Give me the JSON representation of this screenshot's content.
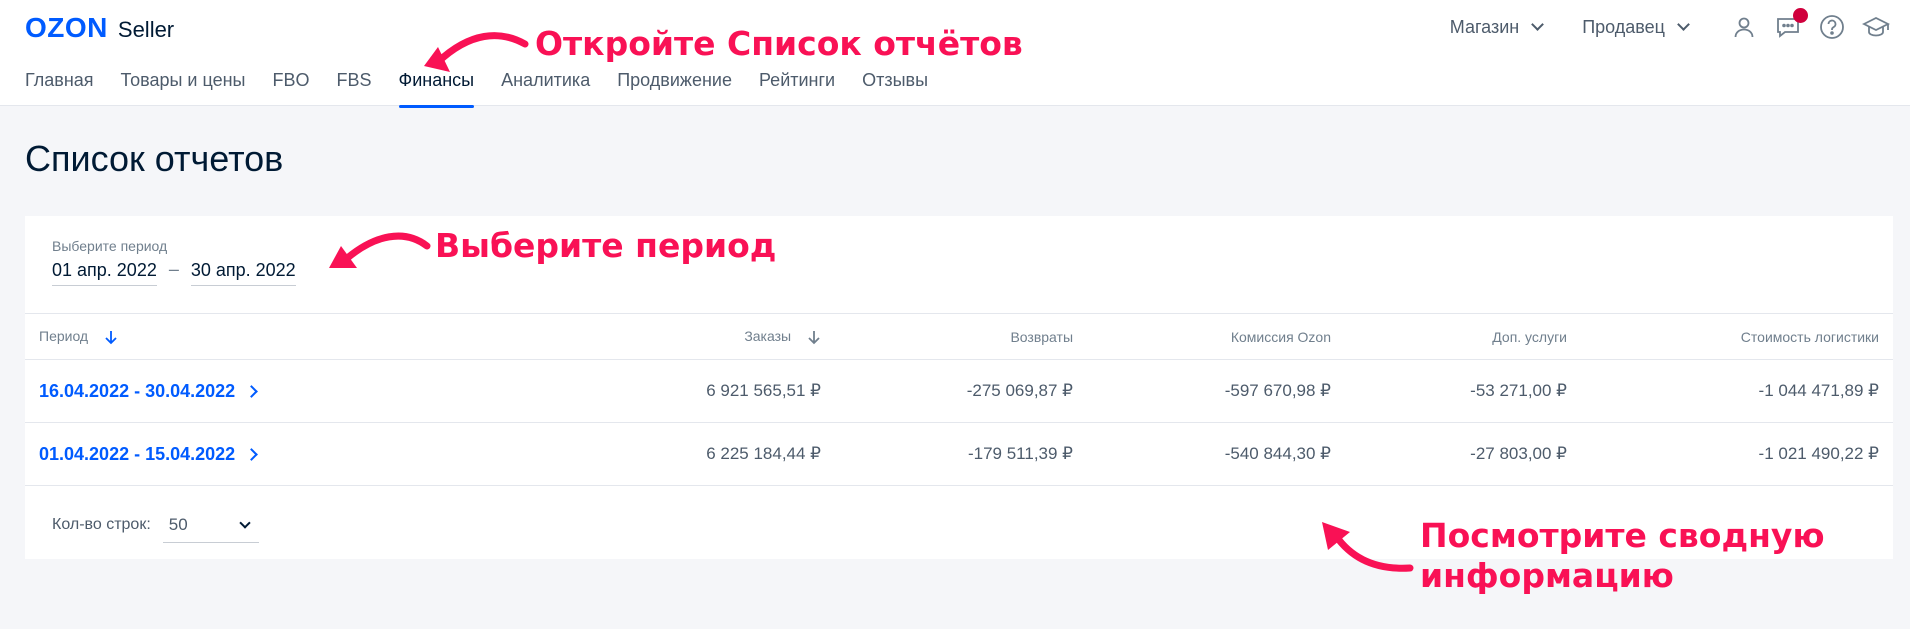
{
  "header": {
    "logo_brand": "OZON",
    "logo_product": "Seller",
    "store_dropdown": "Магазин",
    "seller_dropdown": "Продавец",
    "icons": [
      "user-icon",
      "chat-icon",
      "help-icon",
      "education-icon"
    ],
    "chat_has_notification": true
  },
  "nav": {
    "items": [
      {
        "label": "Главная"
      },
      {
        "label": "Товары и цены"
      },
      {
        "label": "FBO"
      },
      {
        "label": "FBS"
      },
      {
        "label": "Финансы",
        "active": true
      },
      {
        "label": "Аналитика"
      },
      {
        "label": "Продвижение"
      },
      {
        "label": "Рейтинги"
      },
      {
        "label": "Отзывы"
      }
    ]
  },
  "page": {
    "title": "Список отчетов"
  },
  "period_picker": {
    "label": "Выберите период",
    "date_from": "01 апр. 2022",
    "separator": "–",
    "date_to": "30 апр. 2022"
  },
  "table": {
    "columns": [
      "Период",
      "Заказы",
      "Возвраты",
      "Комиссия Ozon",
      "Доп. услуги",
      "Стоимость логистики"
    ],
    "rows": [
      {
        "period": "16.04.2022 - 30.04.2022",
        "orders": "6 921 565,51 ₽",
        "returns": "-275 069,87 ₽",
        "commission": "-597 670,98 ₽",
        "extra_services": "-53 271,00 ₽",
        "logistics": "-1 044 471,89 ₽"
      },
      {
        "period": "01.04.2022 - 15.04.2022",
        "orders": "6 225 184,44 ₽",
        "returns": "-179 511,39 ₽",
        "commission": "-540 844,30 ₽",
        "extra_services": "-27 803,00 ₽",
        "logistics": "-1 021 490,22 ₽"
      }
    ]
  },
  "pagination": {
    "rows_label": "Кол-во строк:",
    "rows_value": "50"
  },
  "annotations": {
    "open_reports": "Откройте Список отчётов",
    "choose_period": "Выберите период",
    "view_summary": "Посмотрите сводную информацию"
  },
  "colors": {
    "brand": "#005bff",
    "annotation": "#f91155",
    "badge": "#d0003d"
  }
}
